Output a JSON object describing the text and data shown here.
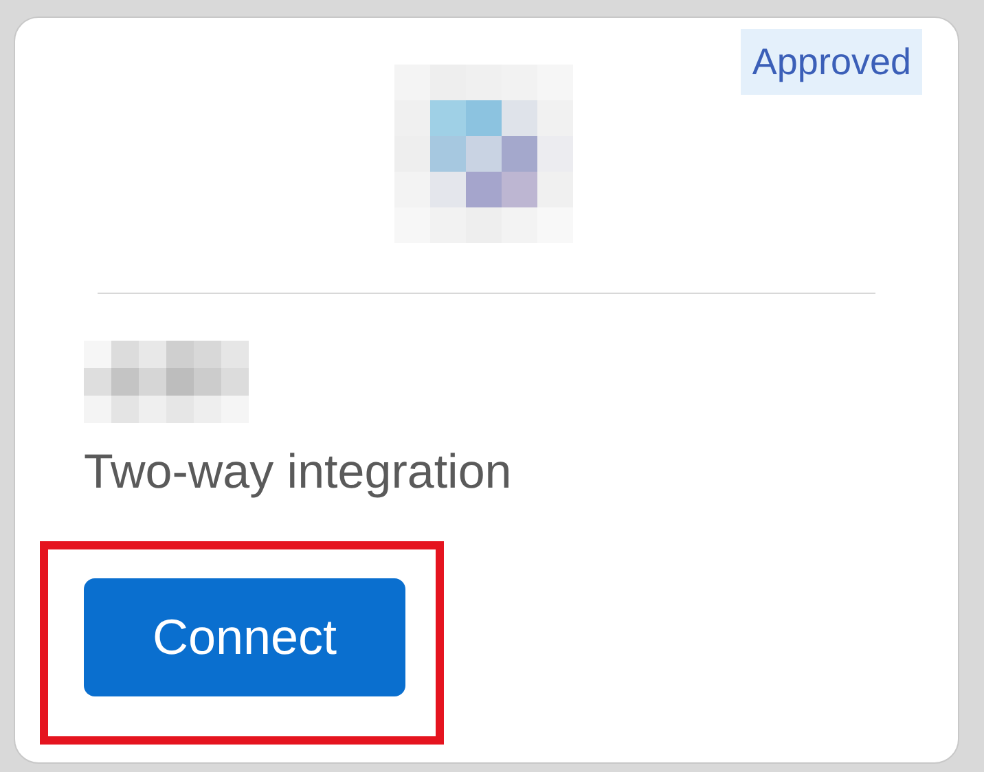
{
  "card": {
    "badge": "Approved",
    "description": "Two-way integration",
    "connect_button": {
      "label": "Connect",
      "highlighted": true
    }
  }
}
